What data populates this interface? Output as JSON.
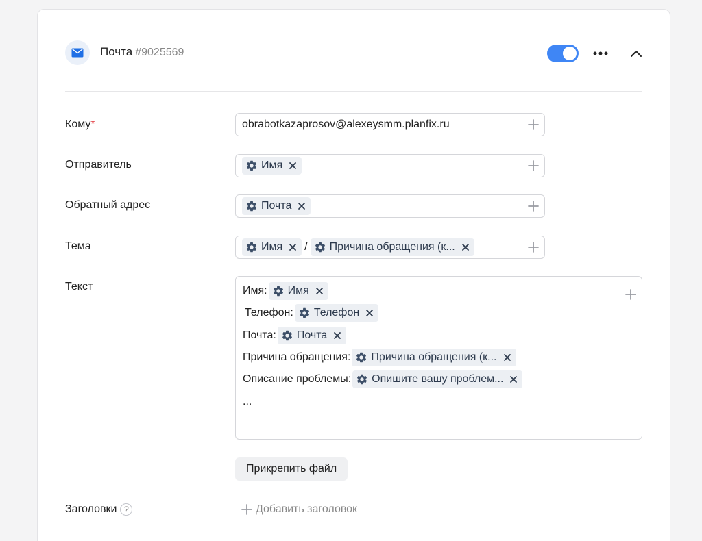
{
  "header": {
    "title": "Почта",
    "id_label": "#9025569",
    "toggle_on": true,
    "accent_color": "#3f86f5"
  },
  "fields": {
    "to": {
      "label": "Кому",
      "required_mark": "*",
      "value": "obrabotkazaprosov@alexeysmm.planfix.ru"
    },
    "sender": {
      "label": "Отправитель",
      "chips": [
        "Имя"
      ]
    },
    "reply_to": {
      "label": "Обратный адрес",
      "chips": [
        "Почта"
      ]
    },
    "subject": {
      "label": "Тема",
      "chips": [
        "Имя",
        "Причина обращения (к..."
      ],
      "separator": "/"
    },
    "text": {
      "label": "Текст",
      "lines": [
        {
          "label": "Имя:",
          "chip": "Имя"
        },
        {
          "label": "Телефон:",
          "chip": "Телефон"
        },
        {
          "label": "Почта:",
          "chip": "Почта"
        },
        {
          "label": "Причина обращения:",
          "chip": "Причина обращения (к..."
        },
        {
          "label": "Описание проблемы:",
          "chip": "Опишите вашу проблем..."
        }
      ],
      "ellipsis": "..."
    }
  },
  "attach_button": "Прикрепить файл",
  "headers_section": {
    "label": "Заголовки",
    "help_glyph": "?",
    "add_label": "Добавить заголовок"
  },
  "icons": {
    "mail": "mail-icon",
    "gear": "gear-icon",
    "close": "close-icon",
    "plus": "plus-icon",
    "more": "more-horizontal-icon",
    "collapse": "chevron-up-icon"
  }
}
